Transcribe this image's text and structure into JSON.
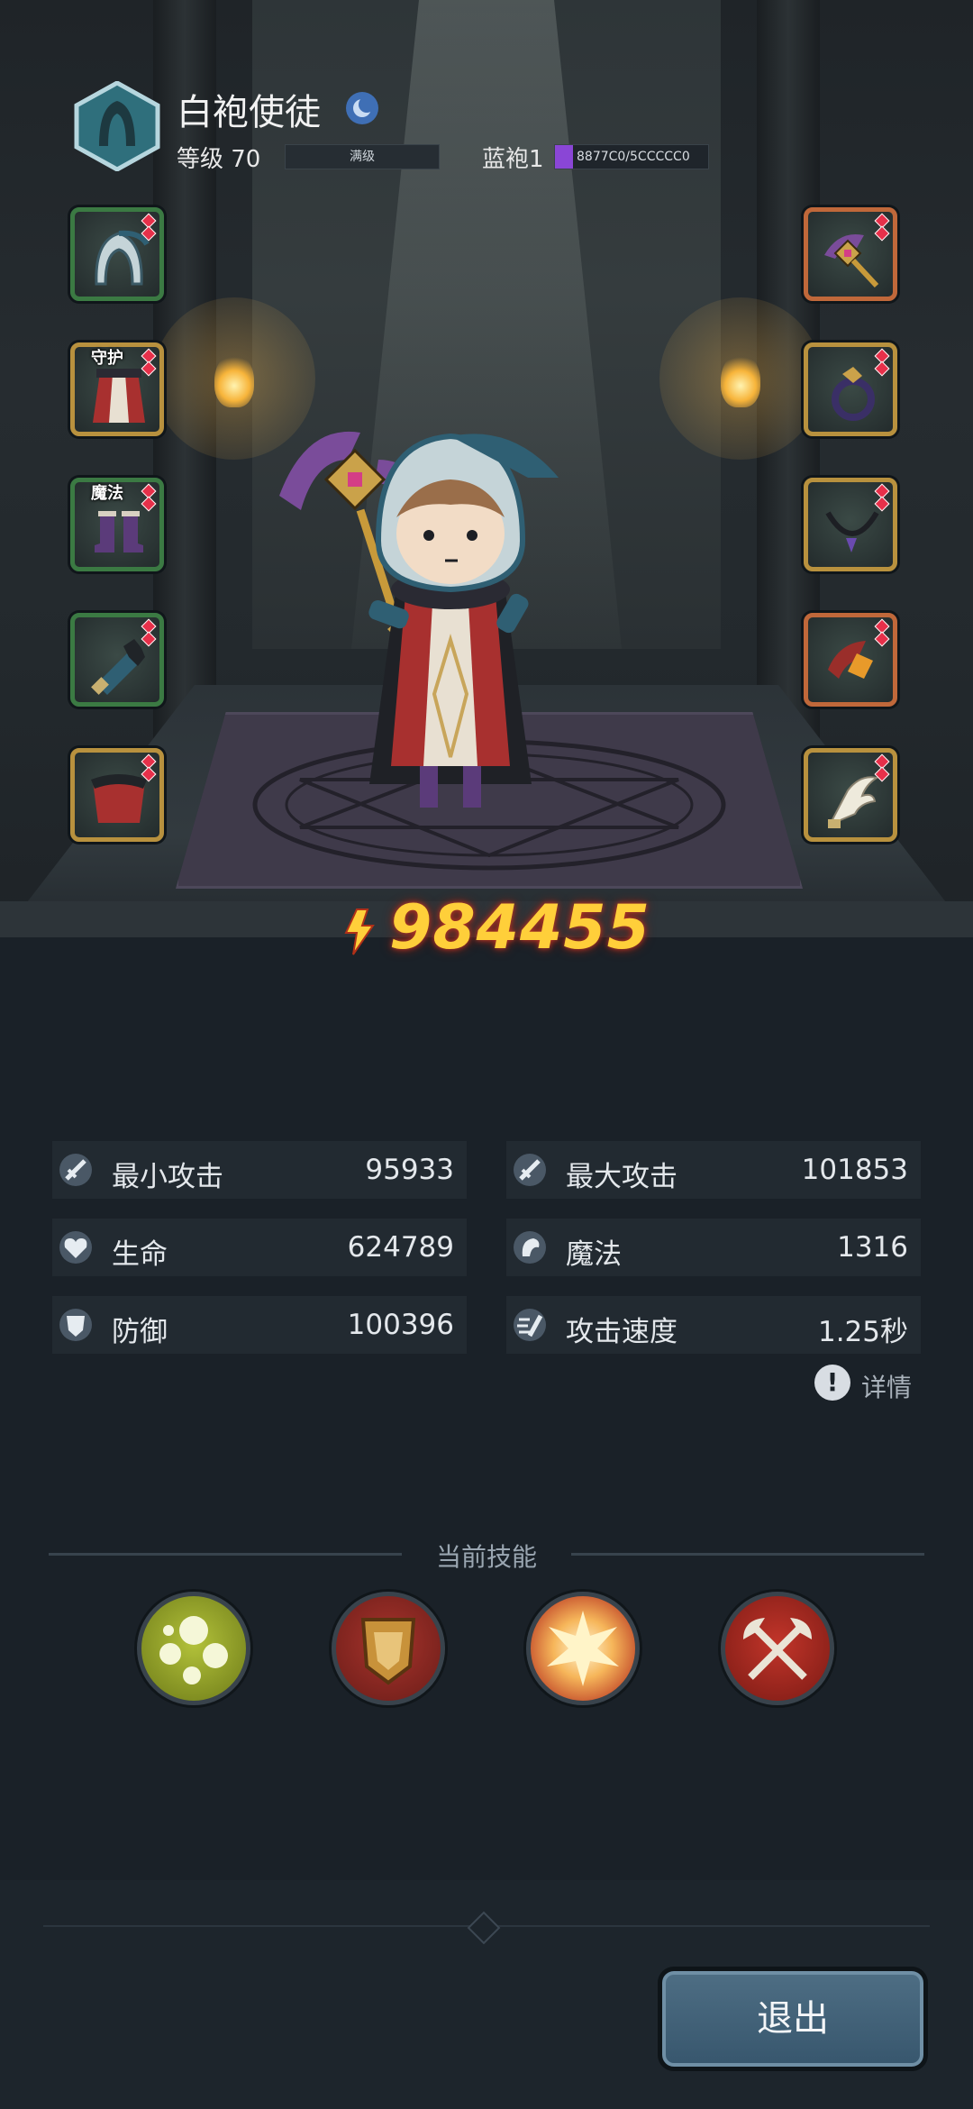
{
  "header": {
    "class_name": "白袍使徒",
    "level_label": "等级 70",
    "level_status": "满级",
    "robe_label": "蓝袍1",
    "robe_progress_text": "8877C0/5CCCCC0",
    "robe_progress_fraction": 0.12
  },
  "equipment": {
    "left": [
      {
        "name": "hood",
        "tag": ""
      },
      {
        "name": "robe",
        "tag": "守护"
      },
      {
        "name": "boots",
        "tag": "魔法"
      },
      {
        "name": "bracer",
        "tag": ""
      },
      {
        "name": "cape",
        "tag": ""
      }
    ],
    "right": [
      {
        "name": "staff",
        "tag": ""
      },
      {
        "name": "ring",
        "tag": ""
      },
      {
        "name": "necklace",
        "tag": ""
      },
      {
        "name": "amulet",
        "tag": ""
      },
      {
        "name": "wing-charm",
        "tag": ""
      }
    ]
  },
  "power": "984455",
  "stats": [
    {
      "label": "最小攻击",
      "value": "95933",
      "icon": "sword-icon"
    },
    {
      "label": "最大攻击",
      "value": "101853",
      "icon": "sword-icon"
    },
    {
      "label": "生命",
      "value": "624789",
      "icon": "heart-icon"
    },
    {
      "label": "魔法",
      "value": "1316",
      "icon": "magic-icon"
    },
    {
      "label": "防御",
      "value": "100396",
      "icon": "shield-icon"
    },
    {
      "label": "攻击速度",
      "value": "1.25秒",
      "icon": "speed-icon"
    }
  ],
  "detail_label": "详情",
  "skills_title": "当前技能",
  "skills": [
    {
      "name": "poison-bubbles"
    },
    {
      "name": "guardian-shield"
    },
    {
      "name": "burst"
    },
    {
      "name": "crossed-axes"
    }
  ],
  "exit_label": "退出",
  "colors": {
    "background": "#1a2128",
    "power": "#ffcf3a",
    "robe_progress": "#8a46d6",
    "slot_green": "#3b7a43",
    "slot_gold": "#b8913e",
    "exit_button": "#4e6e84"
  }
}
